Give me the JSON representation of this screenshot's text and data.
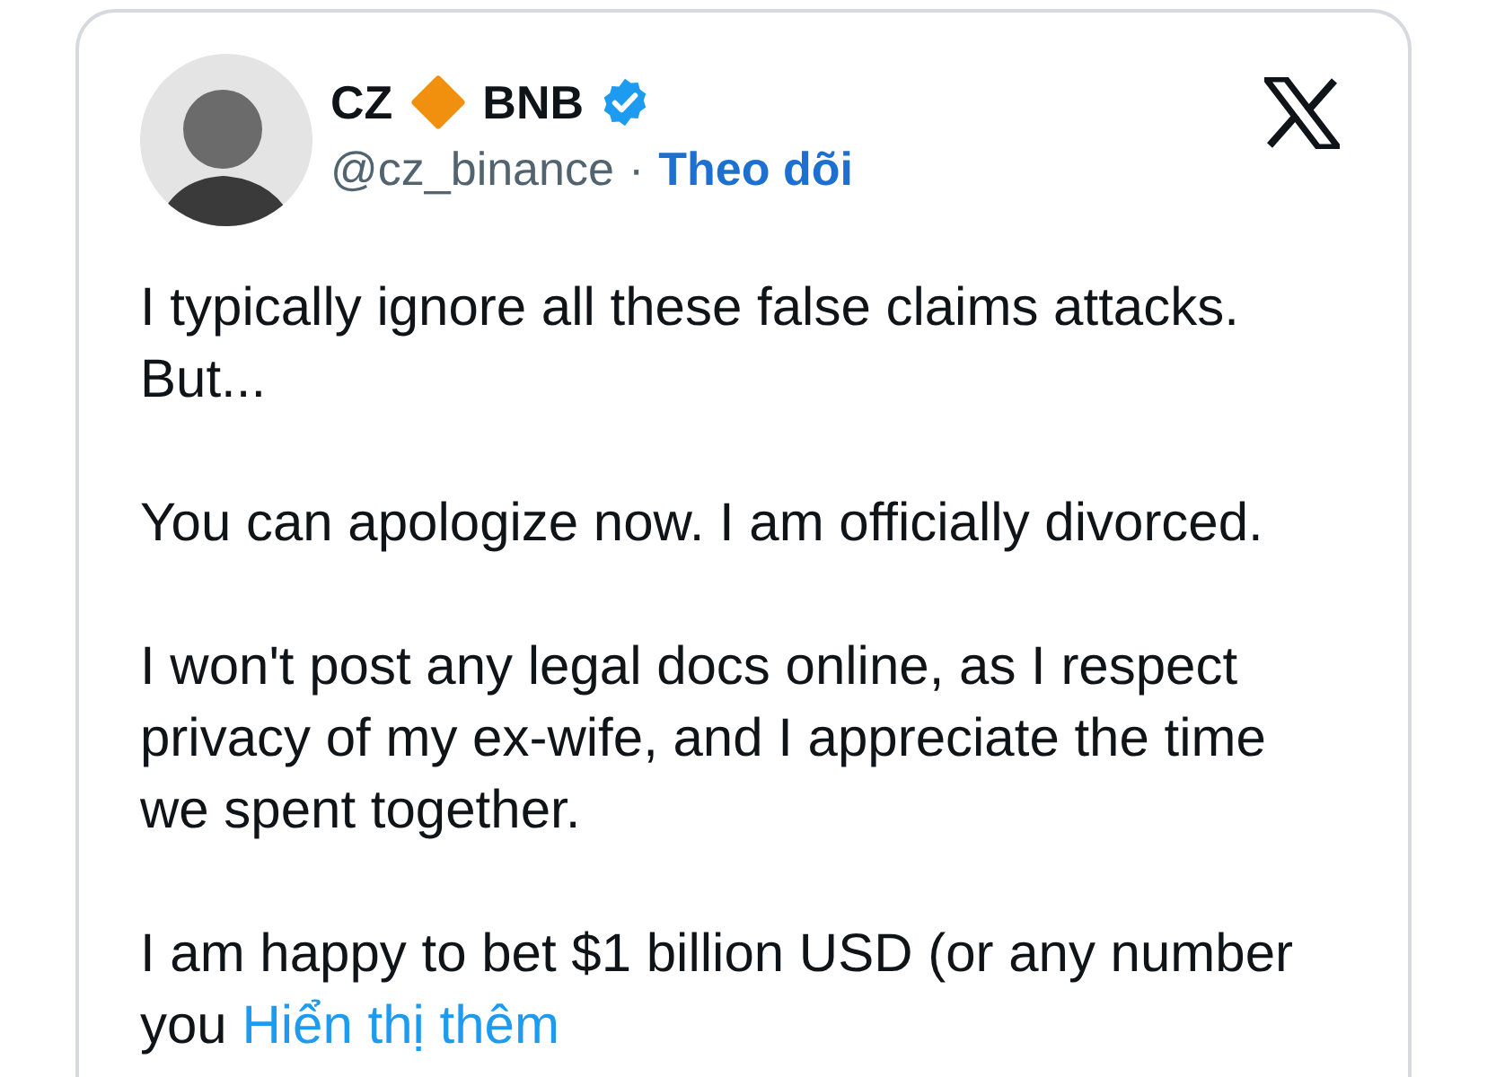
{
  "author": {
    "name": "CZ",
    "ticker": "BNB",
    "verified": true,
    "handle": "@cz_binance",
    "separator": "·",
    "follow": "Theo dõi"
  },
  "paragraphs": [
    "I typically ignore all these false claims attacks. But...",
    "You can apologize now. I am officially divorced.",
    "I won't post any legal docs online, as I respect privacy of my ex-wife, and I appreciate the time we spent together.",
    "I am happy to bet $1 billion USD (or any number you"
  ],
  "show_more": "Hiển thị thêm"
}
